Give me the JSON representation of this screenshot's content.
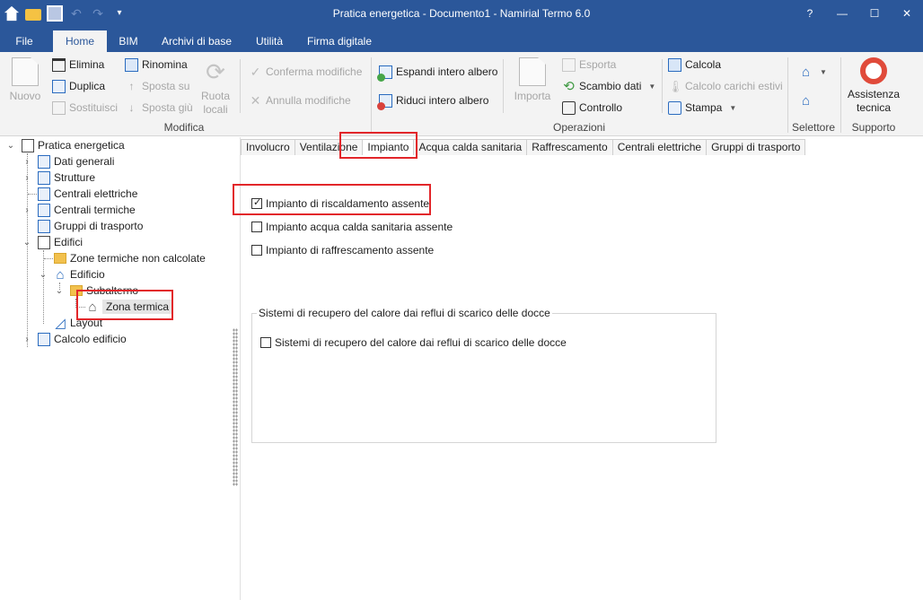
{
  "window": {
    "title": "Pratica energetica - Documento1 - Namirial Termo 6.0",
    "help": "?",
    "minimize": "—",
    "maximize": "☐",
    "close": "✕"
  },
  "quick_access": {
    "undo": "↶",
    "redo": "↷",
    "more": "▾"
  },
  "ribbon_tabs": [
    "File",
    "Home",
    "BIM",
    "Archivi di base",
    "Utilità",
    "Firma digitale"
  ],
  "ribbon": {
    "modifica": {
      "label": "Modifica",
      "nuovo": "Nuovo",
      "elimina": "Elimina",
      "duplica": "Duplica",
      "sostituisci": "Sostituisci",
      "rinomina": "Rinomina",
      "sposta_su": "Sposta su",
      "sposta_giu": "Sposta giù",
      "ruota_1": "Ruota",
      "ruota_2": "locali",
      "conferma": "Conferma modifiche",
      "annulla": "Annulla modifiche"
    },
    "tree_tools": {
      "espandi": "Espandi intero albero",
      "riduci": "Riduci intero albero"
    },
    "operazioni": {
      "label": "Operazioni",
      "importa": "Importa",
      "esporta": "Esporta",
      "scambio": "Scambio dati",
      "controllo": "Controllo",
      "calcola": "Calcola",
      "carichi": "Calcolo carichi estivi",
      "stampa": "Stampa"
    },
    "selettore": {
      "label": "Selettore"
    },
    "supporto": {
      "label": "Supporto",
      "assistenza_1": "Assistenza",
      "assistenza_2": "tecnica"
    }
  },
  "tree": {
    "root": "Pratica energetica",
    "dati_generali": "Dati generali",
    "strutture": "Strutture",
    "centrali_elettriche": "Centrali elettriche",
    "centrali_termiche": "Centrali termiche",
    "gruppi_trasporto": "Gruppi di trasporto",
    "edifici": "Edifici",
    "zone_non_calcolate": "Zone termiche non calcolate",
    "edificio": "Edificio",
    "subalterno": "Subalterno",
    "zona_termica": "Zona termica",
    "layout": "Layout",
    "calcolo_edificio": "Calcolo edificio"
  },
  "panel_tabs": [
    "Involucro",
    "Ventilazione",
    "Impianto",
    "Acqua calda sanitaria",
    "Raffrescamento",
    "Centrali elettriche",
    "Gruppi di trasporto"
  ],
  "impianto": {
    "risc_assente": {
      "label": "Impianto di riscaldamento assente",
      "checked": true
    },
    "acs_assente": {
      "label": "Impianto acqua calda sanitaria assente",
      "checked": false
    },
    "raff_assente": {
      "label": "Impianto di raffrescamento assente",
      "checked": false
    },
    "recupero_group_title": "Sistemi di recupero del calore dai reflui di scarico delle docce",
    "recupero": {
      "label": "Sistemi di recupero del calore dai reflui di scarico delle docce",
      "checked": false
    }
  },
  "colors": {
    "titlebar": "#2b579a",
    "ribbon": "#f3f3f3",
    "highlight": "#e2262a"
  }
}
